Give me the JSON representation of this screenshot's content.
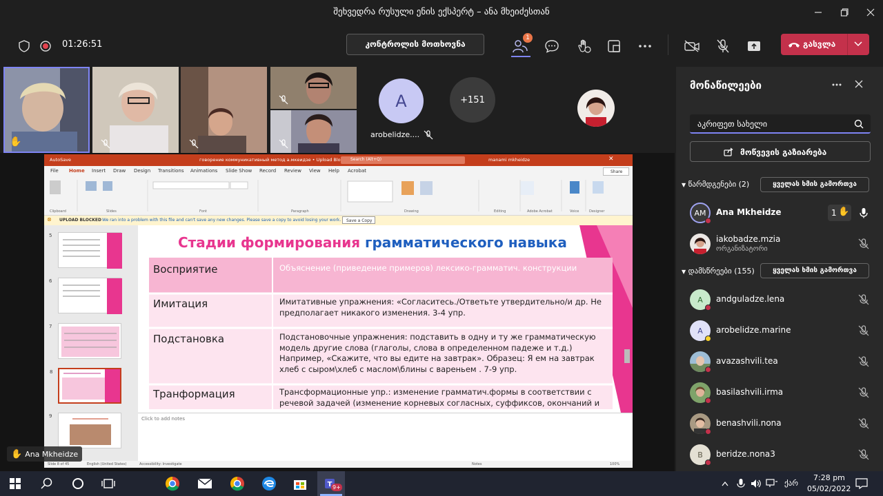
{
  "window": {
    "title": "შეხვედრა რუსული ენის ექსპერტ – ანა მხეიძესთან"
  },
  "toolbar": {
    "timer": "01:26:51",
    "request_control_label": "კონტროლის მოთხოვნა",
    "participants_badge": "1",
    "leave_label": "გასვლა"
  },
  "videos": {
    "avatar_initial": "A",
    "avatar_name": "arobelidze....",
    "overflow_count": "+151",
    "raised_hand_name": "Ana Mkheidze"
  },
  "ppt": {
    "titlebar_text": "говорение коммуникативный метод а.мкеидзе • Upload Blocked",
    "search_placeholder": "Search (Alt+Q)",
    "user_name": "manami mkheidze",
    "autosave": "AutoSave",
    "menu": [
      "File",
      "Home",
      "Insert",
      "Draw",
      "Design",
      "Transitions",
      "Animations",
      "Slide Show",
      "Record",
      "Review",
      "View",
      "Help",
      "Acrobat"
    ],
    "share_label": "Share",
    "ribbon_groups": [
      "Clipboard",
      "Slides",
      "Font",
      "Paragraph",
      "Drawing",
      "Editing",
      "Adobe Acrobat",
      "Voice",
      "Designer"
    ],
    "warning_label": "UPLOAD BLOCKED",
    "warning_text": "We ran into a problem with this file and can't save any new changes. Please save a copy to avoid losing your work.",
    "warning_button": "Save a Copy",
    "thumb_numbers": [
      "5",
      "6",
      "7",
      "8",
      "9"
    ],
    "notes_placeholder": "Click to add notes",
    "status_slide": "Slide 8 of 45",
    "status_lang": "English (United States)",
    "status_access": "Accessibility: Investigate",
    "status_notes": "Notes",
    "status_zoom": "100%"
  },
  "slide": {
    "title_part1": "Стадии формирования",
    "title_part2": "грамматического навыка",
    "rows": [
      {
        "label": "Восприятие",
        "text": "Объяснение (приведение примеров) лексико-грамматич. конструкции"
      },
      {
        "label": "Имитация",
        "text": "Имитативные упражнения: «Согласитесь./Ответьте утвердительно/и др. Не предполагает никакого изменения.   3-4 упр."
      },
      {
        "label": "Подстановка",
        "text": "Подстановочные упражнения: подставить в одну и ту же грамматическую модель другие слова (глаголы, слова в определенном падеже и т.д.) Например, «Скажите, что вы едите на завтрак». Образец: Я ем на завтрак хлеб с сыром\\хлеб с маслом\\блины с вареньем .  7-9 упр."
      },
      {
        "label": "Транформация",
        "text": "Трансформационные упр.: изменение грамматич.формы в соответствии с речевой задачей (изменение корневых согласных, суффиксов, окончаний и"
      }
    ]
  },
  "pane": {
    "title": "მონაწილეები",
    "search_value": "აკრიფეთ სახელი",
    "share_invite_label": "მოწვევის გაზიარება",
    "presenters_label": "წარმდგენები (2)",
    "attendees_label": "დამსწრეები (155)",
    "mute_all_label": "ყველას ხმის გამორთვა",
    "presenters": [
      {
        "initials": "AM",
        "name": "Ana Mkheidze",
        "hand_count": "1",
        "role": ""
      },
      {
        "initials": "",
        "name": "iakobadze.mzia",
        "hand_count": "",
        "role": "ორგანიზატორი"
      }
    ],
    "attendees": [
      {
        "initials": "A",
        "name": "andguladze.lena"
      },
      {
        "initials": "A",
        "name": "arobelidze.marine"
      },
      {
        "initials": "",
        "name": "avazashvili.tea"
      },
      {
        "initials": "",
        "name": "basilashvili.irma"
      },
      {
        "initials": "",
        "name": "benashvili.nona"
      },
      {
        "initials": "B",
        "name": "beridze.nona3"
      }
    ]
  },
  "taskbar": {
    "lang": "ქარ",
    "time": "7:28 pm",
    "date": "05/02/2022",
    "teams_badge": "9+"
  },
  "colors": {
    "accent": "#6264a7",
    "leave_red": "#c4314b",
    "ppt_orange": "#c43e1c",
    "slide_pink": "#e8368f",
    "slide_blue": "#1f5fbf"
  }
}
